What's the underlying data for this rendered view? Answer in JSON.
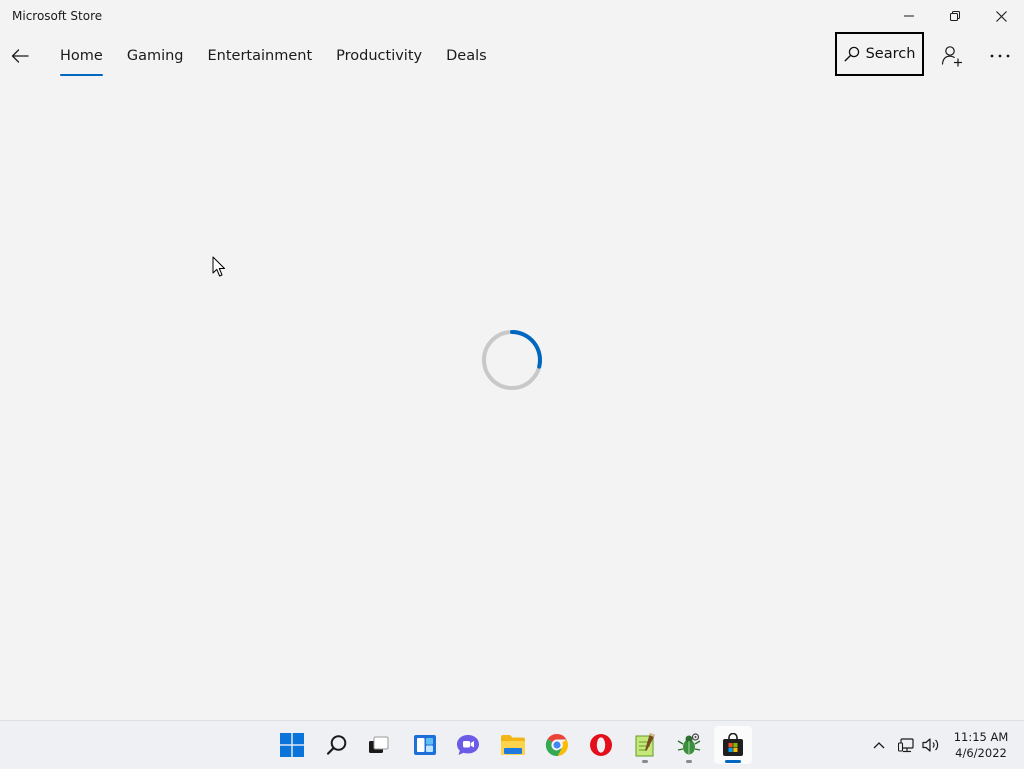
{
  "window": {
    "title": "Microsoft Store",
    "controls": [
      "minimize-icon",
      "restore-icon",
      "close-icon"
    ]
  },
  "nav": {
    "back_icon": "back-arrow-icon",
    "tabs": [
      {
        "label": "Home",
        "active": true
      },
      {
        "label": "Gaming",
        "active": false
      },
      {
        "label": "Entertainment",
        "active": false
      },
      {
        "label": "Productivity",
        "active": false
      },
      {
        "label": "Deals",
        "active": false
      }
    ],
    "search_label": "Search",
    "search_icon": "search-icon",
    "account_icon": "add-account-icon",
    "more_icon": "more-options-icon"
  },
  "content": {
    "state": "loading",
    "spinner_icon": "loading-spinner-icon"
  },
  "taskbar": {
    "apps": [
      {
        "name": "start-menu-icon",
        "running": false,
        "active": false
      },
      {
        "name": "search-icon",
        "running": false,
        "active": false
      },
      {
        "name": "task-view-icon",
        "running": false,
        "active": false
      },
      {
        "name": "widgets-icon",
        "running": false,
        "active": false
      },
      {
        "name": "teams-chat-icon",
        "running": false,
        "active": false
      },
      {
        "name": "file-explorer-icon",
        "running": false,
        "active": false
      },
      {
        "name": "chrome-icon",
        "running": false,
        "active": false
      },
      {
        "name": "opera-icon",
        "running": false,
        "active": false
      },
      {
        "name": "notepad-plus-plus-icon",
        "running": true,
        "active": false
      },
      {
        "name": "bug-app-icon",
        "running": true,
        "active": false
      },
      {
        "name": "microsoft-store-icon",
        "running": true,
        "active": true
      }
    ],
    "tray": {
      "icons": [
        "show-hidden-icons-chevron",
        "network-icon",
        "volume-icon"
      ],
      "time": "11:15 AM",
      "date": "4/6/2022"
    }
  },
  "colors": {
    "accent": "#0067c0",
    "background": "#f3f3f3",
    "taskbar": "#eef0f4"
  }
}
